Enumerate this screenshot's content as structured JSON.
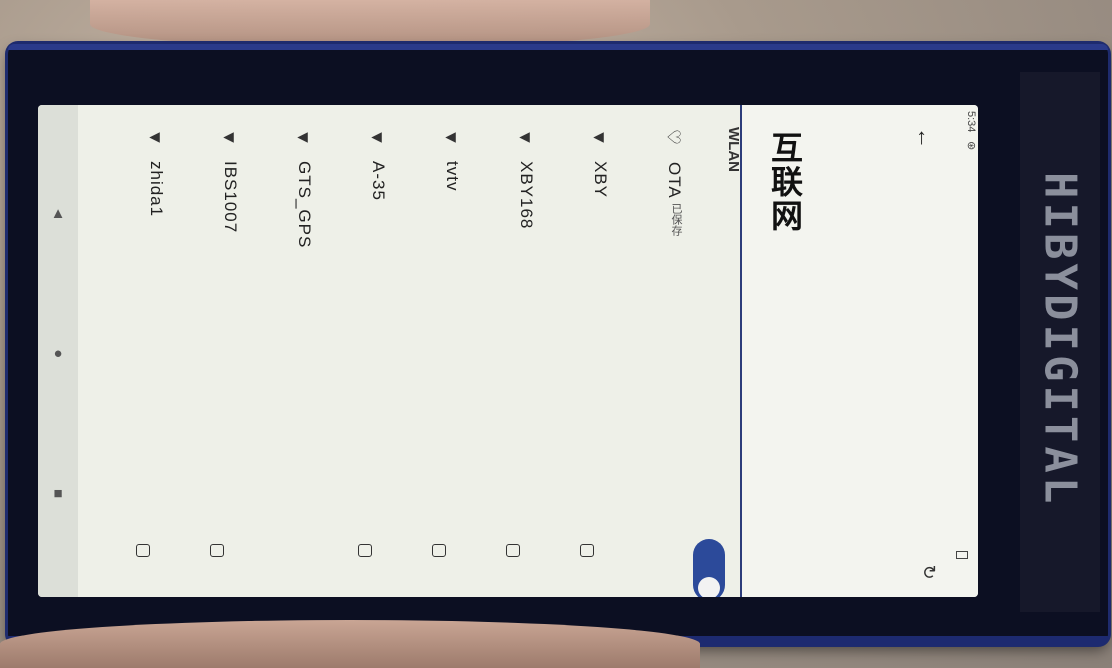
{
  "status_bar": {
    "time": "5:34",
    "extra": "⊛"
  },
  "app_bar": {
    "title": "互联网"
  },
  "wlan": {
    "label": "WLAN",
    "enabled": true
  },
  "networks": [
    {
      "name": "OTA",
      "subtitle": "已保存",
      "signal": "outline",
      "locked": false
    },
    {
      "name": "XBY",
      "subtitle": "",
      "signal": "5",
      "locked": true
    },
    {
      "name": "XBY168",
      "subtitle": "",
      "signal": "4",
      "locked": true
    },
    {
      "name": "tvtv",
      "subtitle": "",
      "signal": "4",
      "locked": true
    },
    {
      "name": "A-35",
      "subtitle": "",
      "signal": "4",
      "locked": true
    },
    {
      "name": "GTS_GPS",
      "subtitle": "",
      "signal": "4",
      "locked": false
    },
    {
      "name": "IBS1007",
      "subtitle": "",
      "signal": "4",
      "locked": true
    },
    {
      "name": "zhida1",
      "subtitle": "",
      "signal": "4",
      "locked": true
    }
  ],
  "device": {
    "brand": "HIBYDIGITAL"
  },
  "colors": {
    "accent": "#2c4a9a",
    "screen_bg": "#eef0e8",
    "device_body": "#0c0f22"
  }
}
